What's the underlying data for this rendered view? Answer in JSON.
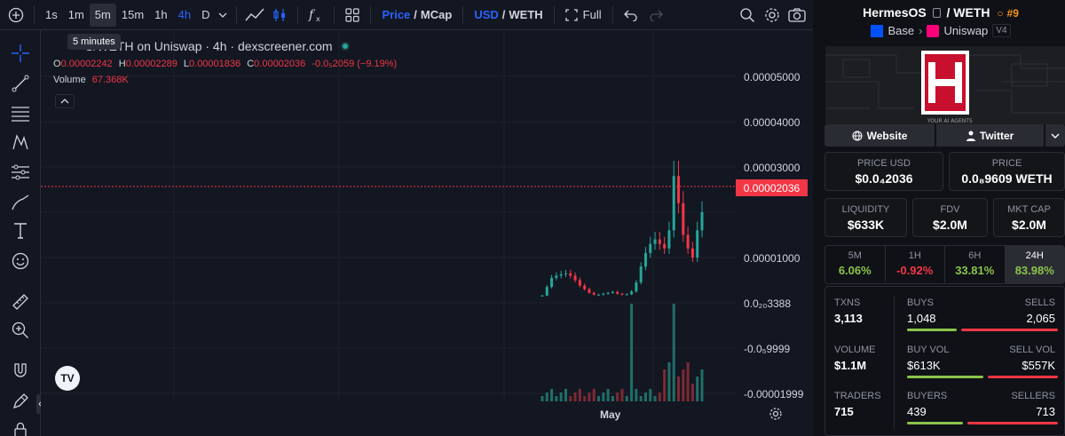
{
  "toolbar": {
    "intervals": [
      "1s",
      "1m",
      "5m",
      "15m",
      "1h",
      "4h",
      "D"
    ],
    "active_interval": "5m",
    "price_label": "Price",
    "mcap_label": "MCap",
    "usd_label": "USD",
    "weth_label": "WETH",
    "full_label": "Full",
    "slash": "/"
  },
  "tooltip": "5 minutes",
  "chart": {
    "pair_title": "S/WETH on Uniswap · 4h · dexscreener.com",
    "ohlc": {
      "o_label": "O",
      "o": "0.00002242",
      "h_label": "H",
      "h": "0.00002289",
      "l_label": "L",
      "l": "0.00001836",
      "c_label": "C",
      "c": "0.00002036",
      "change": "-0.0₅2059 (−9.19%)"
    },
    "volume_label": "Volume",
    "volume_value": "67.368K",
    "y_ticks": [
      "0.00005000",
      "0.00004000",
      "0.00003000",
      "0.00001000",
      "0.0₂₀3388",
      "-0.0₅9999",
      "-0.00001999"
    ],
    "current_price": "0.00002036",
    "x_label": "May",
    "logo": "TV"
  },
  "chart_data": {
    "type": "candlestick",
    "title": "S/WETH on Uniswap · 4h · dexscreener.com",
    "ylabel": "",
    "ylim": [
      -2e-05,
      5e-05
    ],
    "current_price": 2.036e-05,
    "x_tick_labels": [
      "May"
    ],
    "series": [
      {
        "name": "Price",
        "values": [
          1.6e-06,
          3.5e-06,
          5.5e-06,
          6e-06,
          6.3e-06,
          6.5e-06,
          6e-06,
          5e-06,
          3.8e-06,
          3e-06,
          2.2e-06,
          1.8e-06,
          1.8e-06,
          2e-06,
          2.2e-06,
          2.4e-06,
          2e-06,
          1.8e-06,
          1.9e-06,
          2.5e-06,
          4.5e-06,
          8e-06,
          1.1e-05,
          1.3e-05,
          1.4e-05,
          1.3e-05,
          1.2e-05,
          1.6e-05,
          2.8e-05,
          2.2e-05,
          1.5e-05,
          1.2e-05,
          1e-05,
          1.6e-05,
          2e-05
        ]
      }
    ]
  },
  "panel": {
    "token": "HermesOS",
    "quote": "WETH",
    "rank": "#9",
    "chain": "Base",
    "dex": "Uniswap",
    "version": "V4",
    "banner_text": "YOUR AI AGENTS",
    "website_label": "Website",
    "twitter_label": "Twitter",
    "price_usd_label": "PRICE USD",
    "price_usd": "$0.0₄2036",
    "price_label": "PRICE",
    "price_weth": "0.0₈9609 WETH",
    "liquidity_label": "LIQUIDITY",
    "liquidity": "$633K",
    "fdv_label": "FDV",
    "fdv": "$2.0M",
    "mcap_label": "MKT CAP",
    "mcap": "$2.0M",
    "timeframes": [
      {
        "label": "5M",
        "value": "6.06%"
      },
      {
        "label": "1H",
        "value": "-0.92%"
      },
      {
        "label": "6H",
        "value": "33.81%"
      },
      {
        "label": "24H",
        "value": "83.98%"
      }
    ],
    "txns_label": "TXNS",
    "txns": "3,113",
    "buys_label": "BUYS",
    "buys": "1,048",
    "sells_label": "SELLS",
    "sells": "2,065",
    "volume_label": "VOLUME",
    "volume": "$1.1M",
    "buy_vol_label": "BUY VOL",
    "buy_vol": "$613K",
    "sell_vol_label": "SELL VOL",
    "sell_vol": "$557K",
    "traders_label": "TRADERS",
    "traders": "715",
    "buyers_label": "BUYERS",
    "buyers": "439",
    "sellers_label": "SELLERS",
    "sellers": "713",
    "buy_share": 0.34,
    "buy_vol_share": 0.52,
    "buyers_share": 0.38,
    "colors": {
      "green": "#8bc34a",
      "red": "#f23645",
      "accent": "#2962ff",
      "orange": "#f7931a"
    }
  }
}
